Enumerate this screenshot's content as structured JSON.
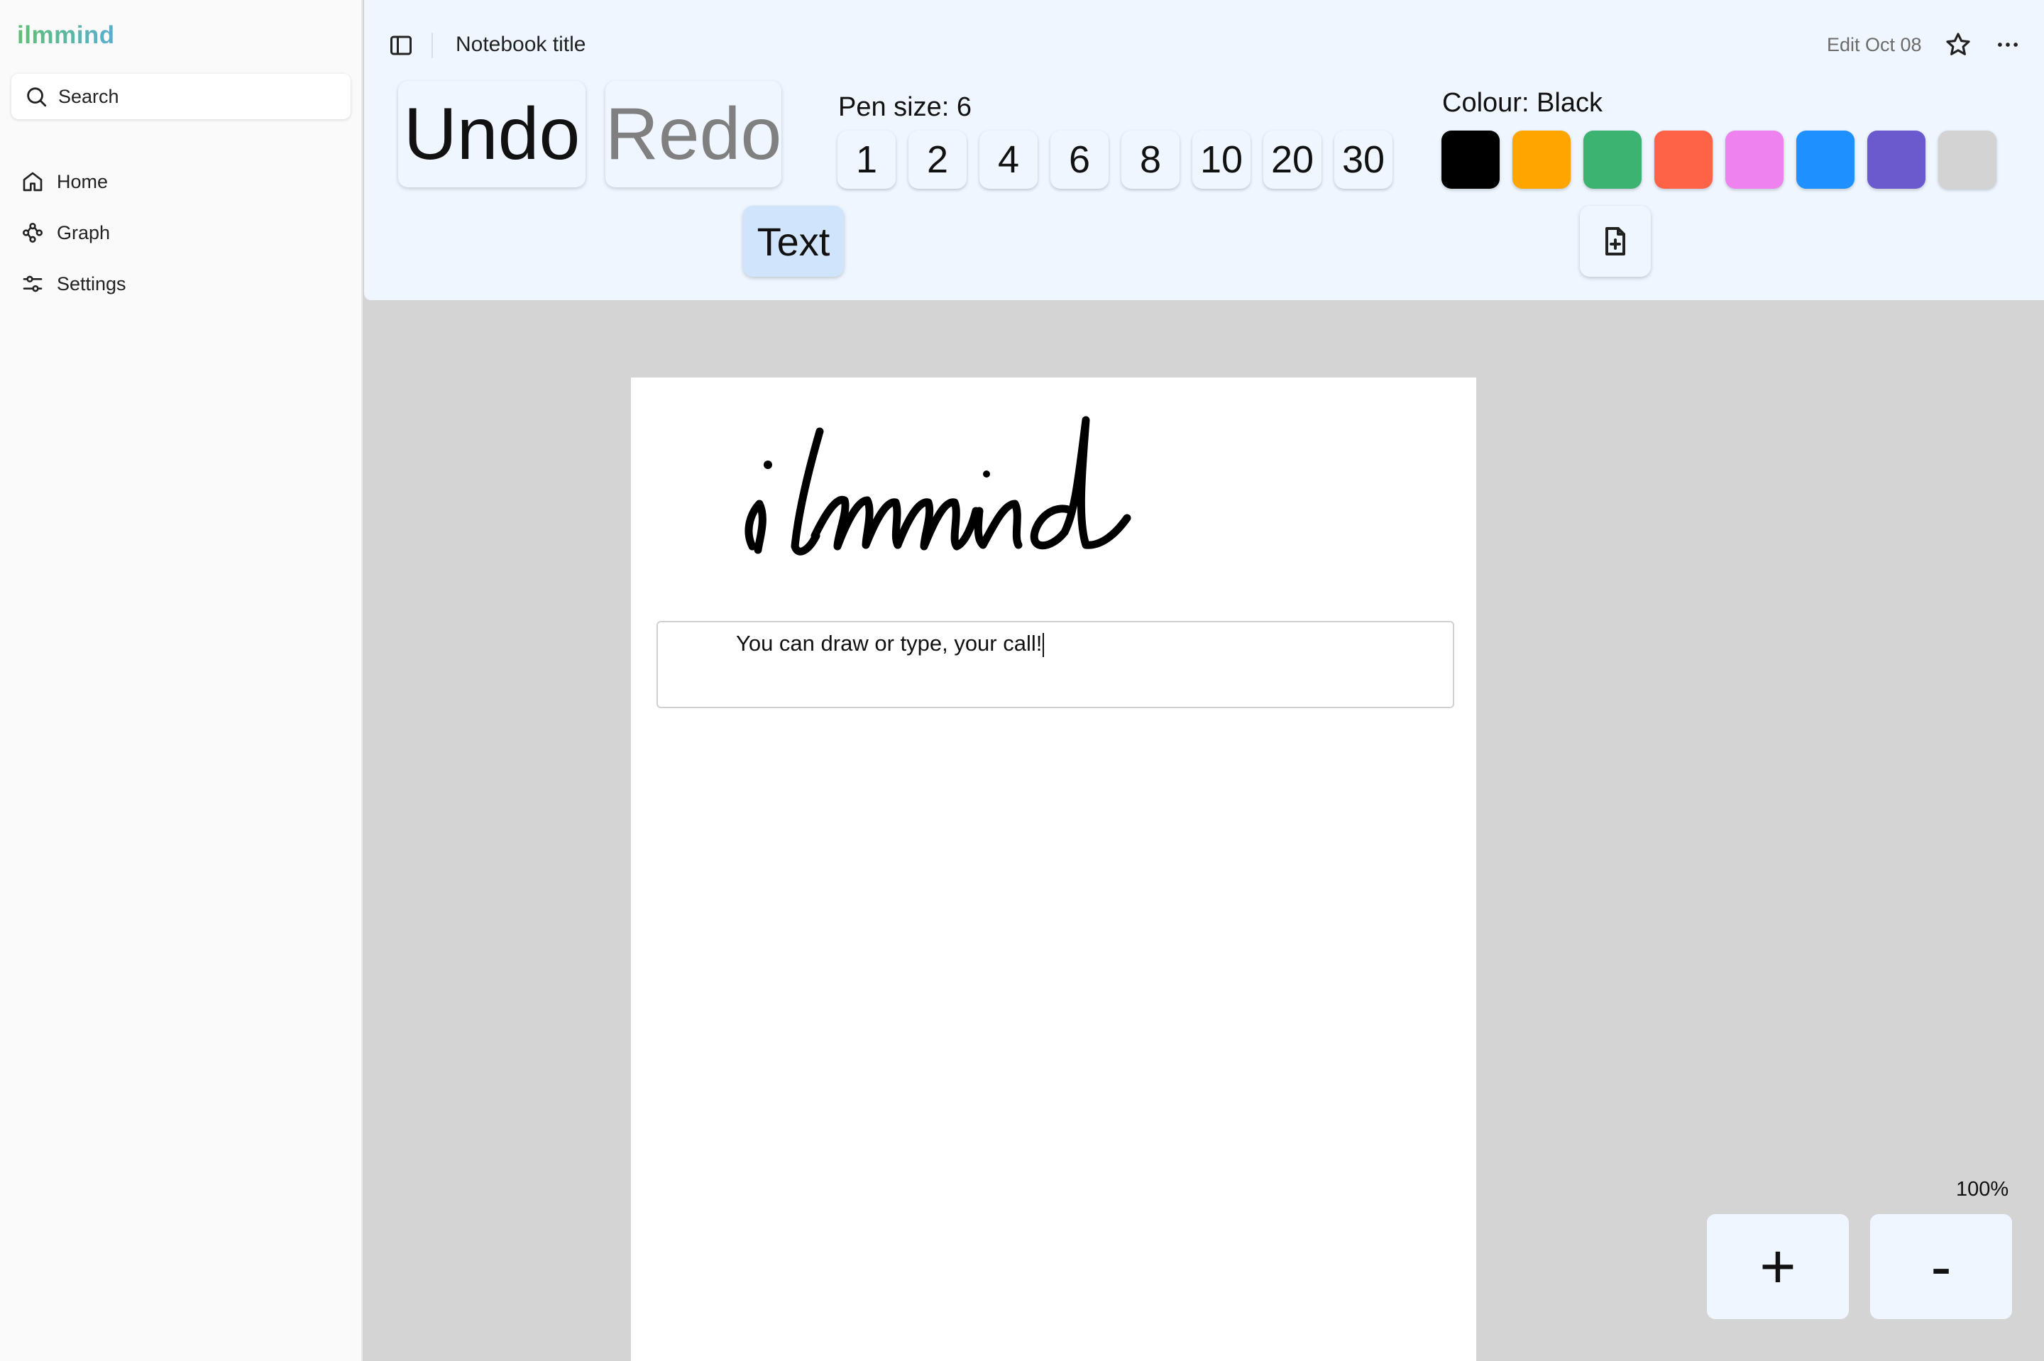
{
  "app": {
    "brand": "ilmmind"
  },
  "sidebar": {
    "search_label": "Search",
    "items": [
      {
        "label": "Home",
        "icon": "home-icon"
      },
      {
        "label": "Graph",
        "icon": "graph-icon"
      },
      {
        "label": "Settings",
        "icon": "settings-icon"
      }
    ]
  },
  "header": {
    "notebook_title": "Notebook title",
    "edit_date": "Edit Oct 08"
  },
  "toolbar": {
    "undo_label": "Undo",
    "redo_label": "Redo",
    "text_label": "Text",
    "pen_size_label": "Pen size: 6",
    "pen_sizes": [
      "1",
      "2",
      "4",
      "6",
      "8",
      "10",
      "20",
      "30"
    ],
    "colour_label": "Colour: Black",
    "colours": [
      {
        "name": "Black",
        "hex": "#000000"
      },
      {
        "name": "Orange",
        "hex": "#ffa500"
      },
      {
        "name": "Green",
        "hex": "#3cb371"
      },
      {
        "name": "Tomato",
        "hex": "#ff6347"
      },
      {
        "name": "Violet",
        "hex": "#ee82ee"
      },
      {
        "name": "Blue",
        "hex": "#1e90ff"
      },
      {
        "name": "Purple",
        "hex": "#6a5acd"
      },
      {
        "name": "Light grey",
        "hex": "#d3d3d3"
      }
    ]
  },
  "canvas": {
    "handwriting": "ilmmind",
    "textbox_text": "You can draw or type, your call!"
  },
  "zoom": {
    "level": "100%",
    "zoom_in_label": "+",
    "zoom_out_label": "-"
  }
}
